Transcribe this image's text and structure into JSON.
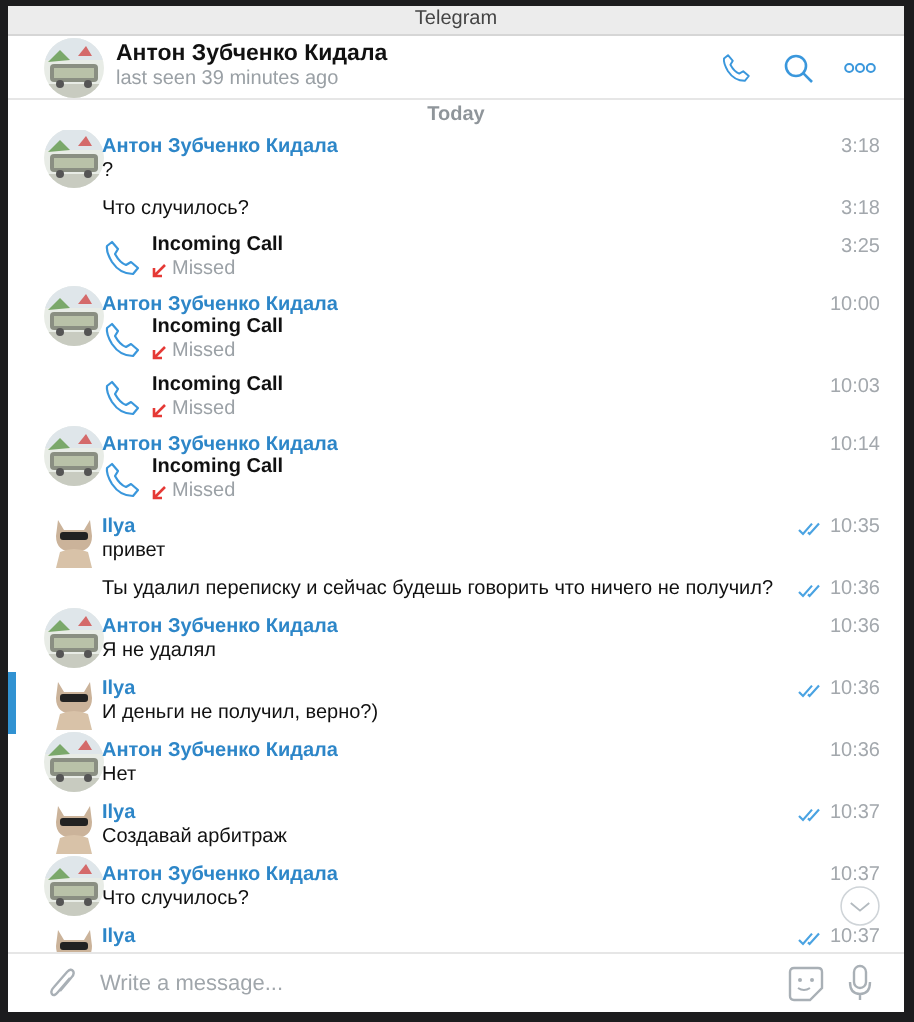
{
  "window": {
    "title": "Telegram"
  },
  "header": {
    "name": "Антон Зубченко Кидала",
    "status": "last seen 39 minutes ago"
  },
  "date_divider": "Today",
  "messages": [
    {
      "sender": "Антон Зубченко Кидала",
      "outgoing": false,
      "kind": "text",
      "text": "?",
      "time": "3:18",
      "read": false,
      "highlighted": false
    },
    {
      "kind": "text",
      "text": "Что случилось?",
      "time": "3:18",
      "read": false,
      "highlighted": false
    },
    {
      "kind": "call",
      "title": "Incoming Call",
      "status": "Missed",
      "time": "3:25",
      "read": false,
      "highlighted": false
    },
    {
      "sender": "Антон Зубченко Кидала",
      "outgoing": false,
      "kind": "call",
      "title": "Incoming Call",
      "status": "Missed",
      "time": "10:00",
      "read": false,
      "highlighted": false
    },
    {
      "kind": "call",
      "title": "Incoming Call",
      "status": "Missed",
      "time": "10:03",
      "read": false,
      "highlighted": false
    },
    {
      "sender": "Антон Зубченко Кидала",
      "outgoing": false,
      "kind": "call",
      "title": "Incoming Call",
      "status": "Missed",
      "time": "10:14",
      "read": false,
      "highlighted": false
    },
    {
      "sender": "Ilya",
      "outgoing": true,
      "kind": "text",
      "text": "привет",
      "time": "10:35",
      "read": true,
      "highlighted": false
    },
    {
      "kind": "text",
      "text": "Ты удалил переписку и сейчас будешь говорить что ничего не получил?",
      "time": "10:36",
      "read": true,
      "highlighted": false
    },
    {
      "sender": "Антон Зубченко Кидала",
      "outgoing": false,
      "kind": "text",
      "text": "Я не удалял",
      "time": "10:36",
      "read": false,
      "highlighted": false
    },
    {
      "sender": "Ilya",
      "outgoing": true,
      "kind": "text",
      "text": "И деньги не получил, верно?)",
      "time": "10:36",
      "read": true,
      "highlighted": true
    },
    {
      "sender": "Антон Зубченко Кидала",
      "outgoing": false,
      "kind": "text",
      "text": "Нет",
      "time": "10:36",
      "read": false,
      "highlighted": false
    },
    {
      "sender": "Ilya",
      "outgoing": true,
      "kind": "text",
      "text": "Создавай арбитраж",
      "time": "10:37",
      "read": true,
      "highlighted": false
    },
    {
      "sender": "Антон Зубченко Кидала",
      "outgoing": false,
      "kind": "text",
      "text": "Что случилось?",
      "time": "10:37",
      "read": false,
      "highlighted": false
    },
    {
      "sender": "Ilya",
      "outgoing": true,
      "kind": "text",
      "time": "10:37",
      "read": true,
      "highlighted": false
    }
  ],
  "composer": {
    "placeholder": "Write a message..."
  }
}
